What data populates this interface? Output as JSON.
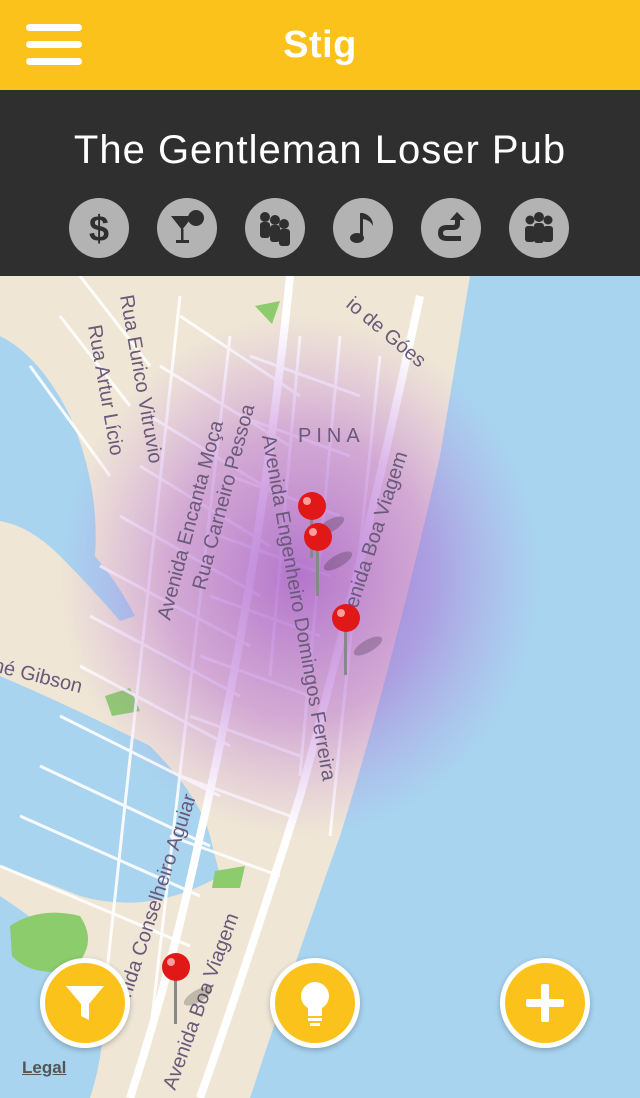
{
  "app": {
    "title": "Stig"
  },
  "venue": {
    "name": "The Gentleman Loser Pub"
  },
  "categories": [
    {
      "id": "price",
      "icon": "dollar-icon"
    },
    {
      "id": "drinks",
      "icon": "cocktail-icon"
    },
    {
      "id": "crowd",
      "icon": "crowd-icon"
    },
    {
      "id": "music",
      "icon": "music-note-icon"
    },
    {
      "id": "directions",
      "icon": "route-icon"
    },
    {
      "id": "people",
      "icon": "group-icon"
    }
  ],
  "map": {
    "labels": {
      "top_street": "io de Góes",
      "rua_eurico": "Rua Eurico Vitruvio",
      "rua_artur": "Rua Artur Lício",
      "pina": "PINA",
      "av_encanta": "Avenida Encanta Moça",
      "rua_carneiro": "Rua Carneiro Pessoa",
      "av_engenheiro": "Avenida Engenheiro Domingos Ferreira",
      "av_boa_viagem_1": "Avenida Boa Viagem",
      "av_boa_viagem_2": "Avenida Boa Viagem",
      "gibson": "né Gibson",
      "av_conselheiro": "Avenida Conselheiro Aguiar"
    },
    "legal": "Legal"
  },
  "actions": {
    "filter": "filter-icon",
    "suggest": "lightbulb-icon",
    "add": "plus-icon"
  },
  "colors": {
    "accent": "#fcc21c",
    "panel": "#2f2f2f",
    "water": "#a8d4ef",
    "heat": "#a050c8"
  }
}
